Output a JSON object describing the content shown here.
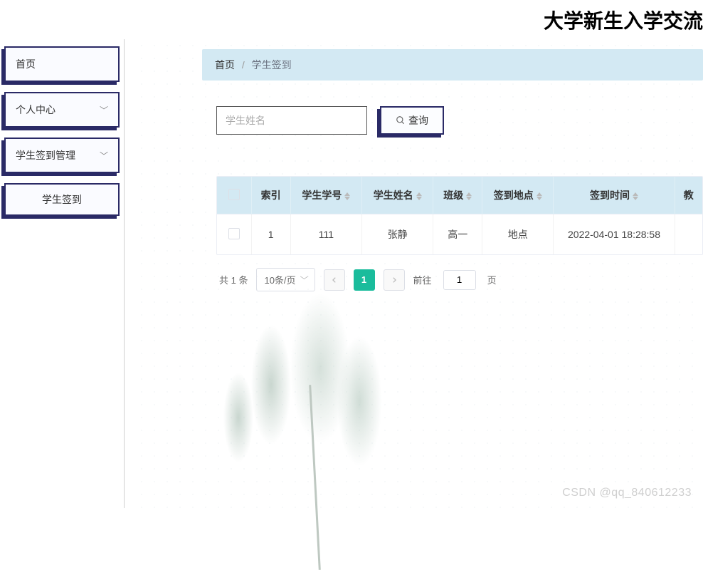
{
  "app": {
    "title": "大学新生入学交流"
  },
  "sidebar": {
    "home": "首页",
    "profile": "个人中心",
    "checkin_mgmt": "学生签到管理",
    "checkin": "学生签到"
  },
  "breadcrumb": {
    "home": "首页",
    "current": "学生签到"
  },
  "search": {
    "placeholder": "学生姓名",
    "query_label": "查询"
  },
  "table": {
    "cols": {
      "index": "索引",
      "student_no": "学生学号",
      "student_name": "学生姓名",
      "class": "班级",
      "location": "签到地点",
      "time": "签到时间",
      "extra": "教"
    },
    "rows": [
      {
        "index": "1",
        "student_no": "111",
        "student_name": "张静",
        "class": "高一",
        "location": "地点",
        "time": "2022-04-01 18:28:58"
      }
    ]
  },
  "pagination": {
    "total_text": "共 1 条",
    "per_page": "10条/页",
    "current": "1",
    "goto_prefix": "前往",
    "goto_value": "1",
    "goto_suffix": "页"
  },
  "watermark": "CSDN @qq_840612233"
}
